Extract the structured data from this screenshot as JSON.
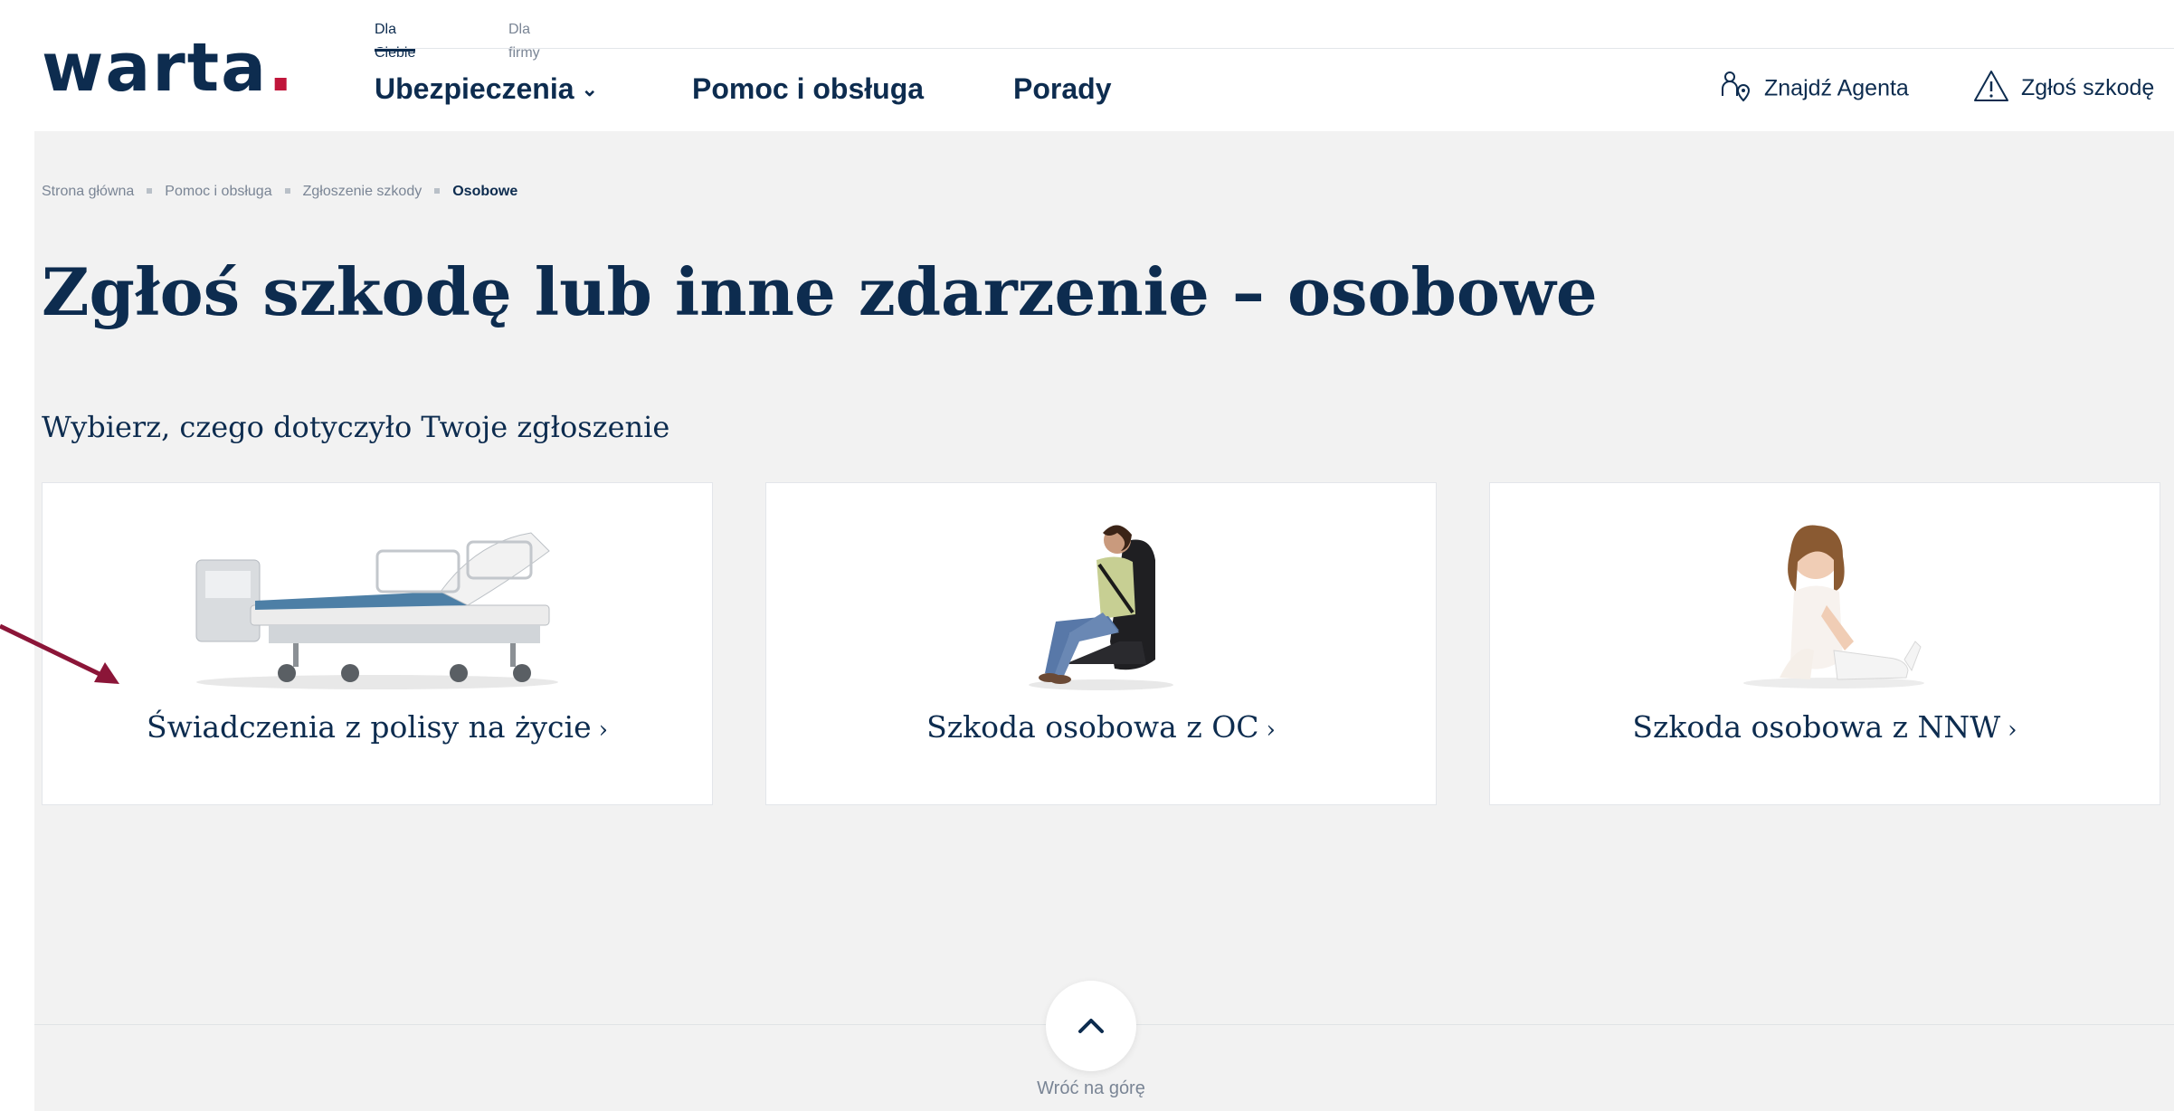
{
  "brand": {
    "logo": "warta",
    "logo_dot": ".",
    "accent": "#c0153a",
    "navy": "#0d2c4f"
  },
  "segments": [
    {
      "label": "Dla Ciebie",
      "active": true
    },
    {
      "label": "Dla firmy",
      "active": false
    }
  ],
  "nav": {
    "insurance": "Ubezpieczenia",
    "help": "Pomoc i obsługa",
    "tips": "Porady"
  },
  "utility": {
    "agent": "Znajdź Agenta",
    "report": "Zgłoś szkodę"
  },
  "breadcrumb": [
    "Strona główna",
    "Pomoc i obsługa",
    "Zgłoszenie szkody",
    "Osobowe"
  ],
  "page_title": "Zgłoś szkodę lub inne zdarzenie – osobowe",
  "subtitle": "Wybierz, czego dotyczyło Twoje zgłoszenie",
  "cards": [
    {
      "label": "Świadczenia z polisy na życie",
      "image": "hospital-bed-image"
    },
    {
      "label": "Szkoda osobowa z OC",
      "image": "woman-in-car-seat-image"
    },
    {
      "label": "Szkoda osobowa z NNW",
      "image": "girl-with-leg-cast-image"
    }
  ],
  "back_to_top": "Wróć na górę",
  "icons": {
    "agent": "person-pin-icon",
    "report": "warning-triangle-icon",
    "chevron": "chevron-down-icon",
    "up": "chevron-up-icon"
  }
}
